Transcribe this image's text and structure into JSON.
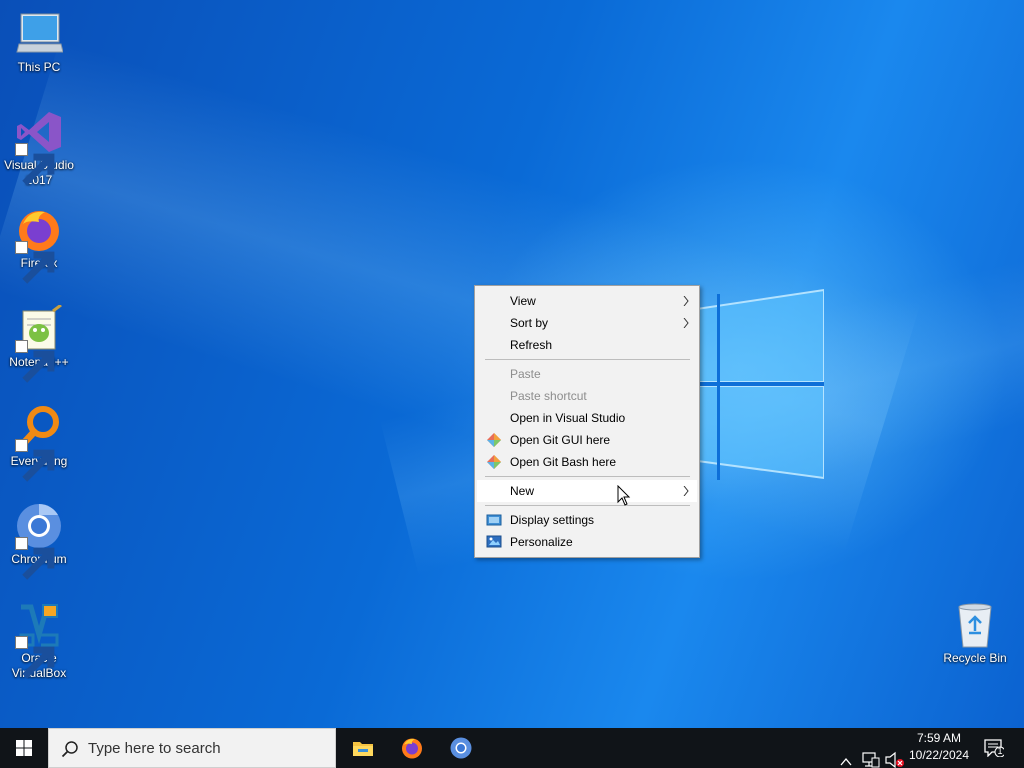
{
  "desktop": {
    "icons": [
      {
        "label": "This PC"
      },
      {
        "label": "Visual Studio 2017"
      },
      {
        "label": "Firefox"
      },
      {
        "label": "Notepad++"
      },
      {
        "label": "Everything"
      },
      {
        "label": "Chromium"
      },
      {
        "label": "Oracle VirtualBox"
      },
      {
        "label": "Recycle Bin"
      }
    ]
  },
  "context_menu": {
    "items": {
      "view": "View",
      "sort_by": "Sort by",
      "refresh": "Refresh",
      "paste": "Paste",
      "paste_shortcut": "Paste shortcut",
      "open_vs": "Open in Visual Studio",
      "git_gui": "Open Git GUI here",
      "git_bash": "Open Git Bash here",
      "new": "New",
      "display_settings": "Display settings",
      "personalize": "Personalize"
    }
  },
  "taskbar": {
    "search_placeholder": "Type here to search",
    "time": "7:59 AM",
    "date": "10/22/2024",
    "notification_count": "1"
  },
  "colors": {
    "taskbar_bg": "#101418",
    "menu_bg": "#f2f2f2",
    "accent": "#0a63c9"
  }
}
